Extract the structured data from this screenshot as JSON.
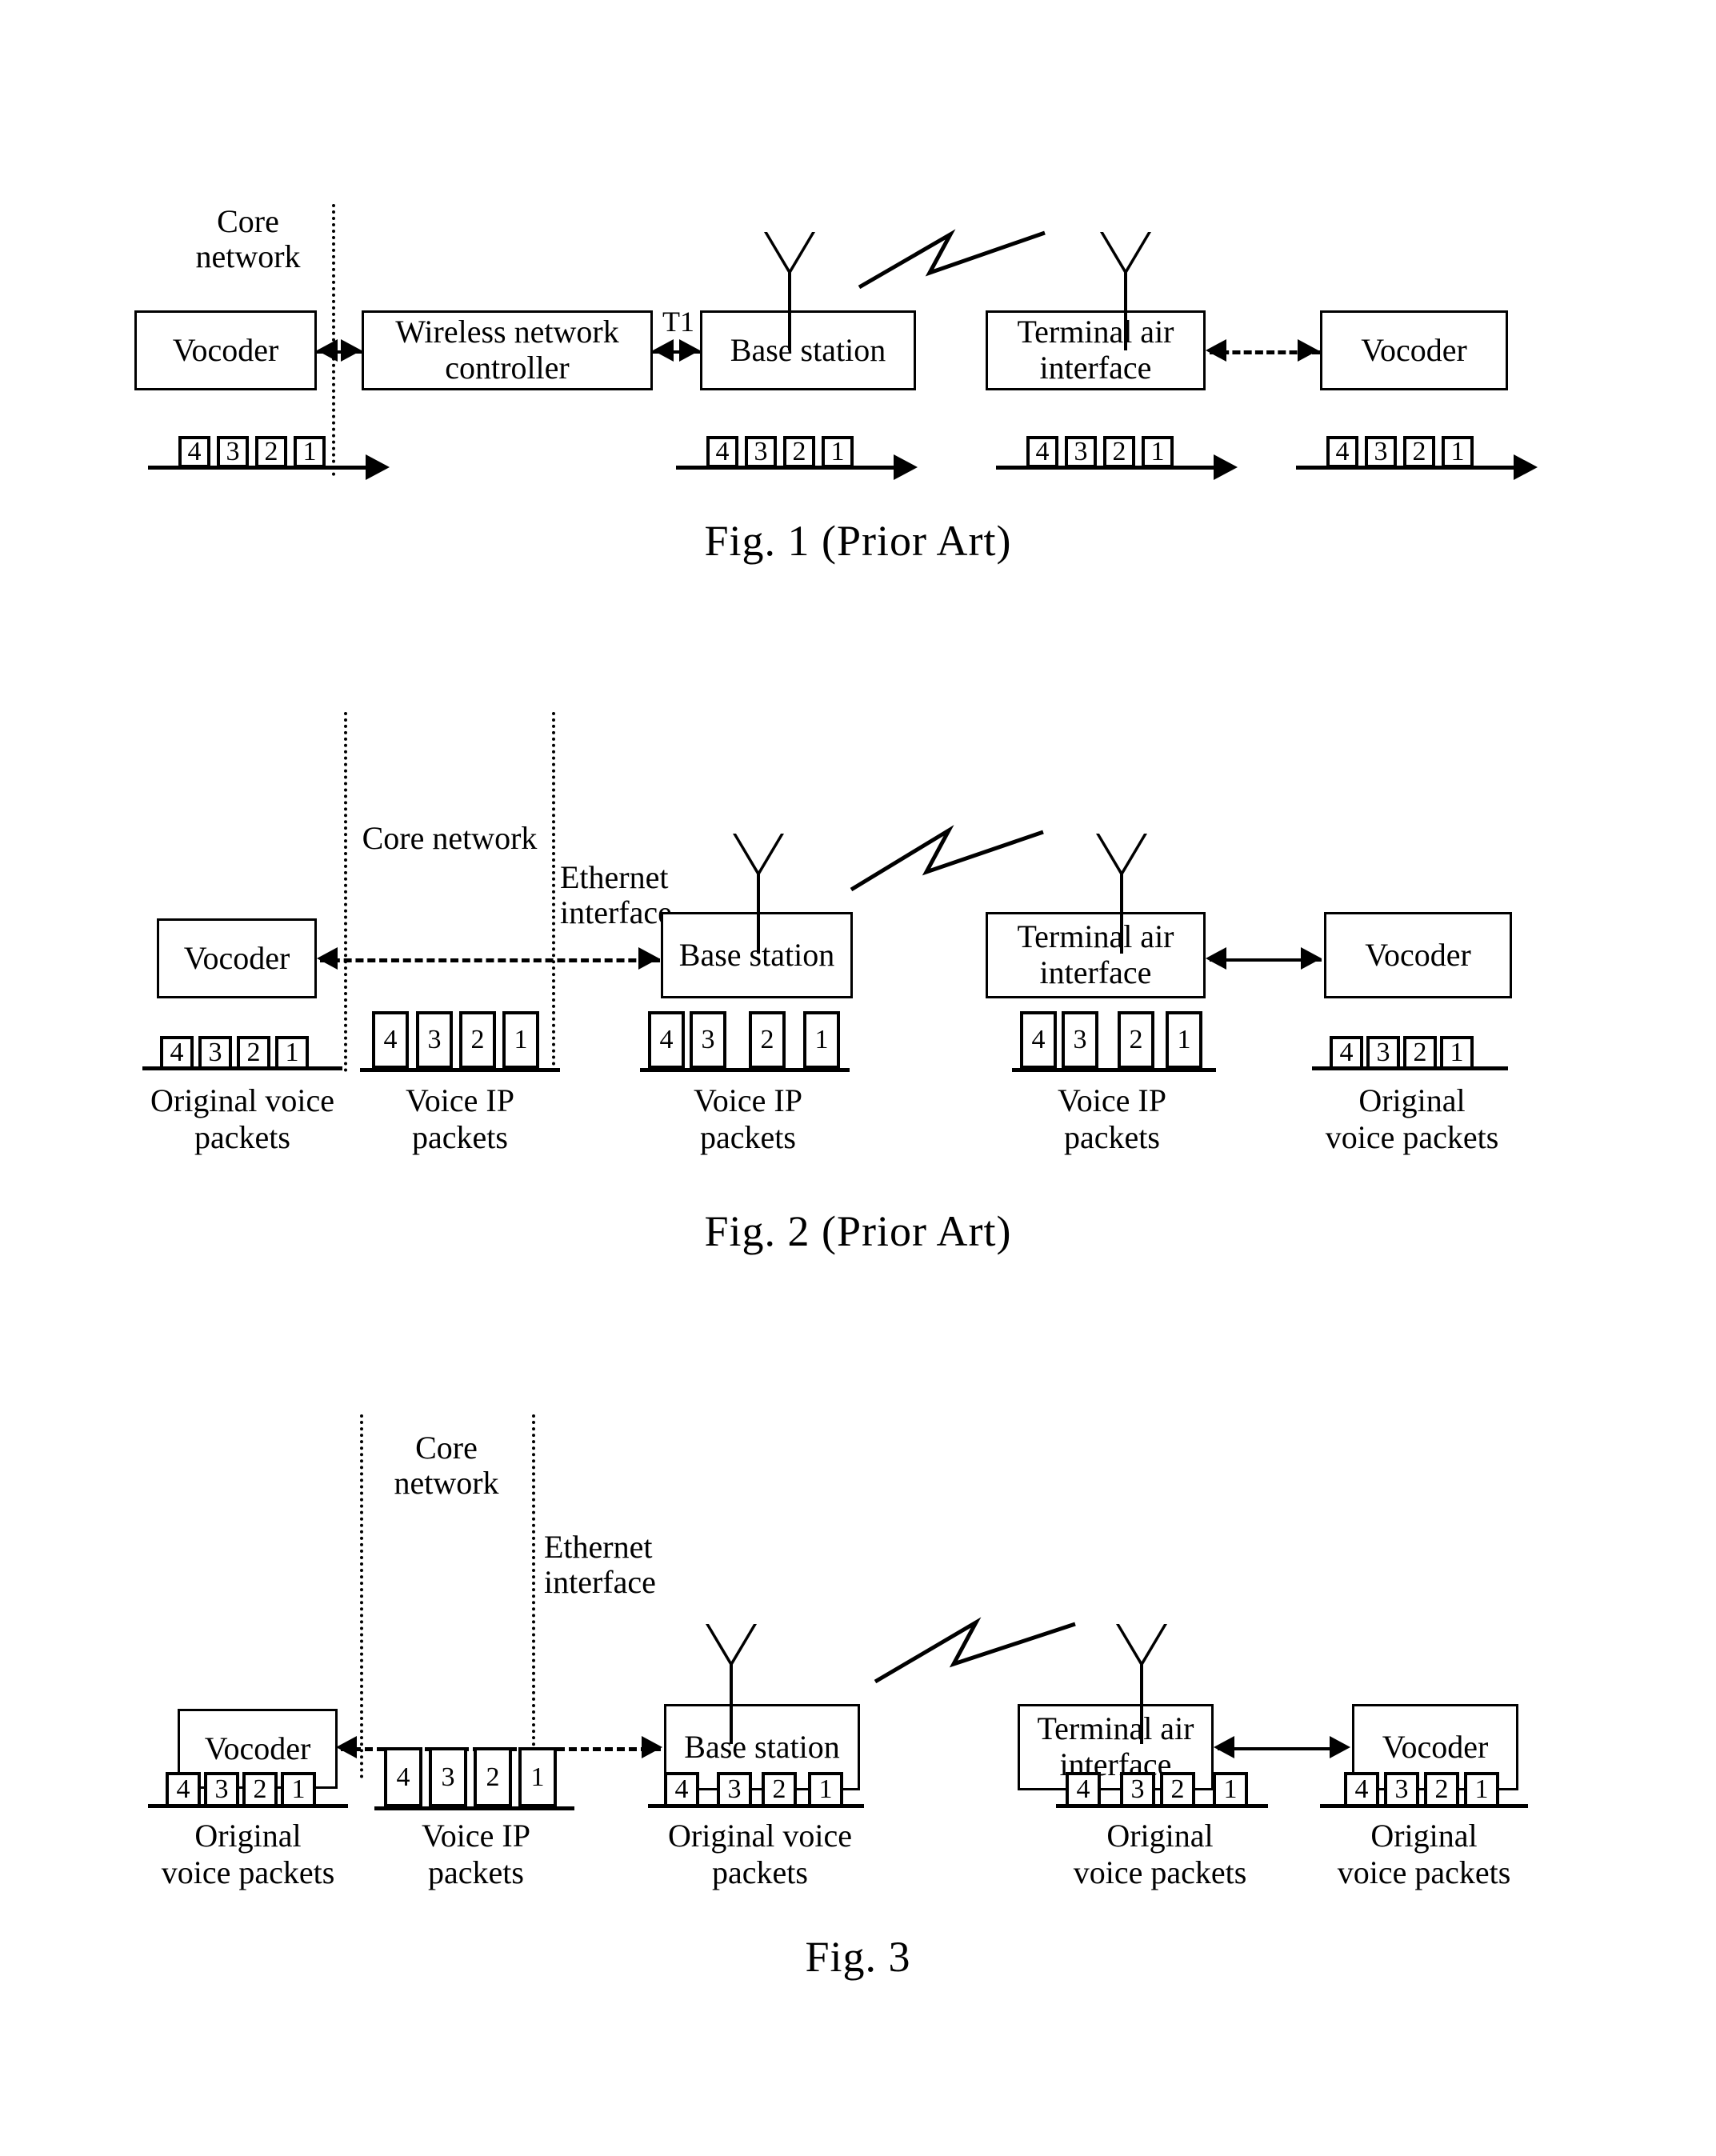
{
  "document": {
    "type": "patent-drawing-sheet",
    "figures": [
      {
        "id": "fig1",
        "caption": "Fig. 1 (Prior Art)",
        "region_labels": [
          {
            "name": "core-network",
            "text": "Core\nnetwork"
          },
          {
            "name": "t1-interface",
            "text": "T1"
          }
        ],
        "nodes": [
          {
            "name": "vocoder-left",
            "label": "Vocoder"
          },
          {
            "name": "wireless-network-controller",
            "label": "Wireless network\ncontroller"
          },
          {
            "name": "base-station",
            "label": "Base station"
          },
          {
            "name": "terminal-air-interface",
            "label": "Terminal air\ninterface"
          },
          {
            "name": "vocoder-right",
            "label": "Vocoder"
          }
        ],
        "packet_trains": [
          {
            "name": "packets-1",
            "cells": [
              "4",
              "3",
              "2",
              "1"
            ],
            "label": ""
          },
          {
            "name": "packets-2",
            "cells": [
              "4",
              "3",
              "2",
              "1"
            ],
            "label": ""
          },
          {
            "name": "packets-3",
            "cells": [
              "4",
              "3",
              "2",
              "1"
            ],
            "label": ""
          },
          {
            "name": "packets-4",
            "cells": [
              "4",
              "3",
              "2",
              "1"
            ],
            "label": ""
          }
        ]
      },
      {
        "id": "fig2",
        "caption": "Fig. 2 (Prior Art)",
        "region_labels": [
          {
            "name": "core-network",
            "text": "Core network"
          },
          {
            "name": "ethernet-interface",
            "text": "Ethernet\ninterface"
          }
        ],
        "nodes": [
          {
            "name": "vocoder-left",
            "label": "Vocoder"
          },
          {
            "name": "base-station",
            "label": "Base\nstation"
          },
          {
            "name": "terminal-air-interface",
            "label": "Terminal air\ninterface"
          },
          {
            "name": "vocoder-right",
            "label": "Vocoder"
          }
        ],
        "packet_trains": [
          {
            "name": "packets-1",
            "cells": [
              "4",
              "3",
              "2",
              "1"
            ],
            "label": "Original voice\npackets"
          },
          {
            "name": "packets-2",
            "cells": [
              "4",
              "3",
              "2",
              "1"
            ],
            "label": "Voice IP\npackets"
          },
          {
            "name": "packets-3",
            "cells": [
              "4",
              "3",
              "2",
              "1"
            ],
            "label": "Voice IP\npackets"
          },
          {
            "name": "packets-4",
            "cells": [
              "4",
              "3",
              "2",
              "1"
            ],
            "label": "Voice IP\npackets"
          },
          {
            "name": "packets-5",
            "cells": [
              "4",
              "3",
              "2",
              "1"
            ],
            "label": "Original\nvoice packets"
          }
        ]
      },
      {
        "id": "fig3",
        "caption": "Fig. 3",
        "region_labels": [
          {
            "name": "core-network",
            "text": "Core\nnetwork"
          },
          {
            "name": "ethernet-interface",
            "text": "Ethernet\ninterface"
          }
        ],
        "nodes": [
          {
            "name": "vocoder-left",
            "label": "Vocoder"
          },
          {
            "name": "base-station",
            "label": "Base\nstation"
          },
          {
            "name": "terminal-air-interface",
            "label": "Terminal\nair interface"
          },
          {
            "name": "vocoder-right",
            "label": "Vocoder"
          }
        ],
        "packet_trains": [
          {
            "name": "packets-1",
            "cells": [
              "4",
              "3",
              "2",
              "1"
            ],
            "label": "Original\nvoice packets"
          },
          {
            "name": "packets-2",
            "cells": [
              "4",
              "3",
              "2",
              "1"
            ],
            "label": "Voice IP\npackets"
          },
          {
            "name": "packets-3",
            "cells": [
              "4",
              "3",
              "2",
              "1"
            ],
            "label": "Original voice\npackets"
          },
          {
            "name": "packets-4",
            "cells": [
              "4",
              "3",
              "2",
              "1"
            ],
            "label": "Original\nvoice packets"
          },
          {
            "name": "packets-5",
            "cells": [
              "4",
              "3",
              "2",
              "1"
            ],
            "label": "Original\nvoice packets"
          }
        ]
      }
    ]
  },
  "colors": {
    "ink": "#000000",
    "paper": "#ffffff"
  }
}
